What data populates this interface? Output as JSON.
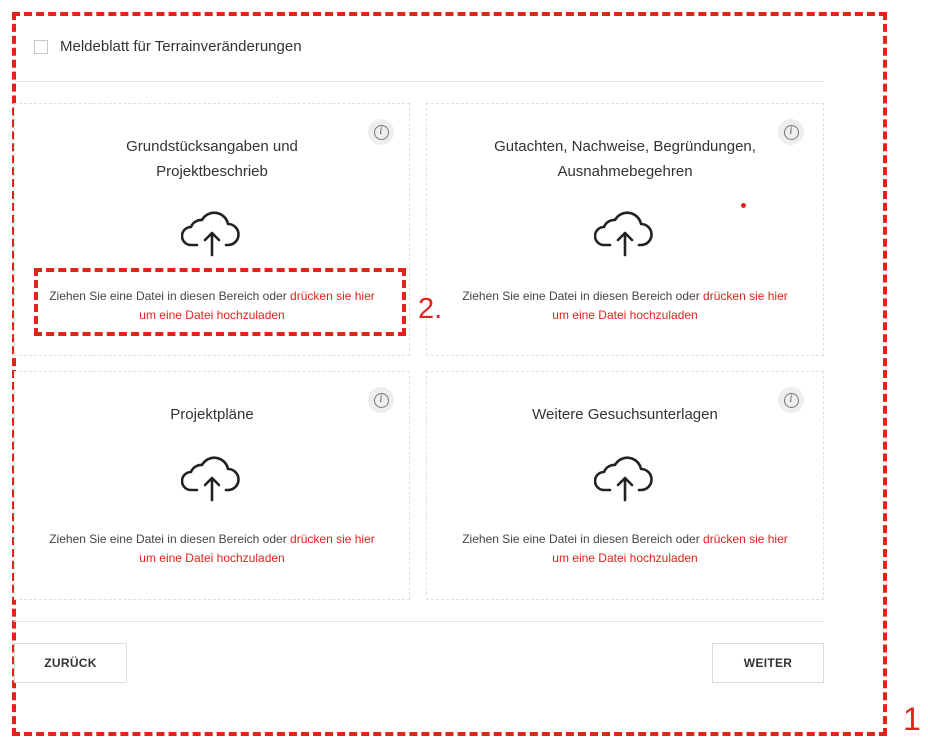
{
  "form": {
    "checkbox_label": "Meldeblatt für Terrainveränderungen",
    "checkbox_checked": false
  },
  "cards": [
    {
      "title": "Grundstücksangaben und Projektbeschrieb",
      "drop_text": "Ziehen Sie eine Datei in diesen Bereich oder ",
      "drop_link": "drücken sie hier um eine Datei hochzuladen",
      "info_icon": "info-icon",
      "upload_icon": "cloud-upload-icon"
    },
    {
      "title": "Gutachten, Nachweise, Begründungen, Ausnahmebegehren",
      "drop_text": "Ziehen Sie eine Datei in diesen Bereich oder ",
      "drop_link": "drücken sie hier um eine Datei hochzuladen",
      "info_icon": "info-icon",
      "upload_icon": "cloud-upload-icon"
    },
    {
      "title": "Projektpläne",
      "drop_text": "Ziehen Sie eine Datei in diesen Bereich oder ",
      "drop_link": "drücken sie hier um eine Datei hochzuladen",
      "info_icon": "info-icon",
      "upload_icon": "cloud-upload-icon"
    },
    {
      "title": "Weitere Gesuchsunterlagen",
      "drop_text": "Ziehen Sie eine Datei in diesen Bereich oder ",
      "drop_link": "drücken sie hier um eine Datei hochzuladen",
      "info_icon": "info-icon",
      "upload_icon": "cloud-upload-icon"
    }
  ],
  "nav": {
    "back_label": "ZURÜCK",
    "next_label": "WEITER"
  },
  "annotations": {
    "marker_1": "1",
    "marker_2": "2."
  },
  "colors": {
    "accent": "#e2231a",
    "border": "#e0e0e0",
    "text": "#333333"
  }
}
